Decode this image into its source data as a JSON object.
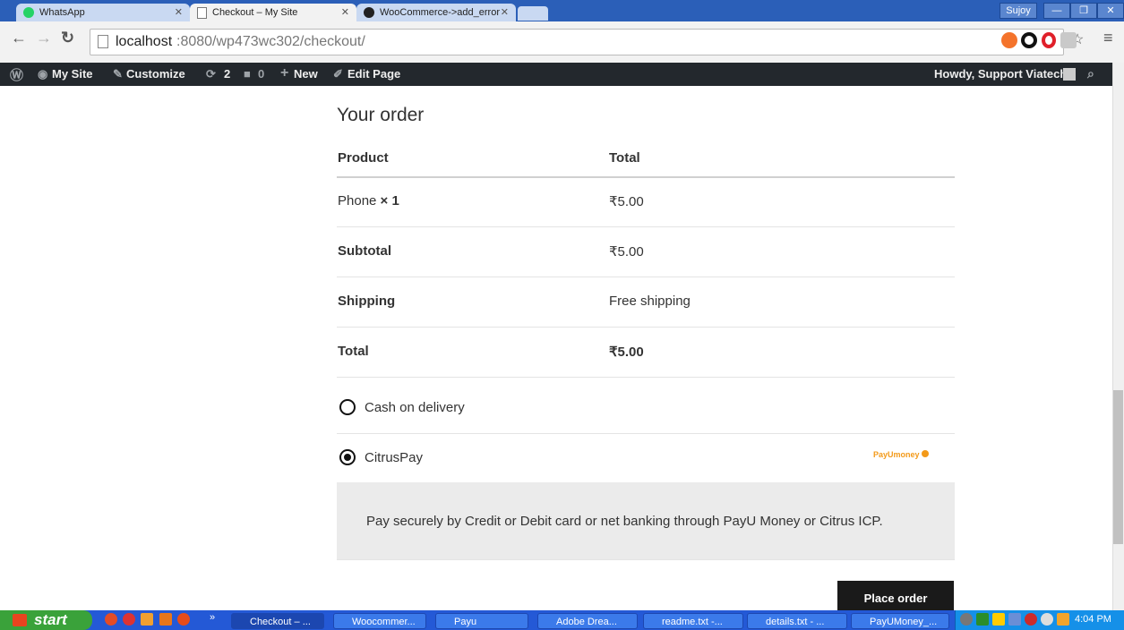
{
  "browser": {
    "tabs": [
      {
        "label": "WhatsApp"
      },
      {
        "label": "Checkout – My Site"
      },
      {
        "label": "WooCommerce->add_error"
      }
    ],
    "user": "Sujoy",
    "url_host": "localhost",
    "url_path": ":8080/wp473wc302/checkout/"
  },
  "adminbar": {
    "my_site": "My Site",
    "customize": "Customize",
    "updates": "2",
    "comments": "0",
    "new": "New",
    "edit_page": "Edit Page",
    "howdy": "Howdy, Support Viatechs"
  },
  "order": {
    "heading": "Your order",
    "col_product": "Product",
    "col_total": "Total",
    "item_name": "Phone",
    "item_qty": "× 1",
    "item_total": "₹5.00",
    "subtotal_label": "Subtotal",
    "subtotal_value": "₹5.00",
    "shipping_label": "Shipping",
    "shipping_value": "Free shipping",
    "total_label": "Total",
    "total_value": "₹5.00"
  },
  "payment": {
    "method_cod": "Cash on delivery",
    "method_citrus": "CitrusPay",
    "selected": "CitrusPay",
    "logo_text": "PayUmoney",
    "description": "Pay securely by Credit or Debit card or net banking through PayU Money or Citrus ICP.",
    "place_order": "Place order"
  },
  "taskbar": {
    "start": "start",
    "tasks": [
      {
        "label": "Checkout – ..."
      },
      {
        "label": "Woocommer..."
      },
      {
        "label": "Payu"
      },
      {
        "label": "Adobe Drea..."
      },
      {
        "label": "readme.txt -..."
      },
      {
        "label": "details.txt - ..."
      },
      {
        "label": "PayUMoney_..."
      }
    ],
    "clock": "4:04 PM"
  }
}
